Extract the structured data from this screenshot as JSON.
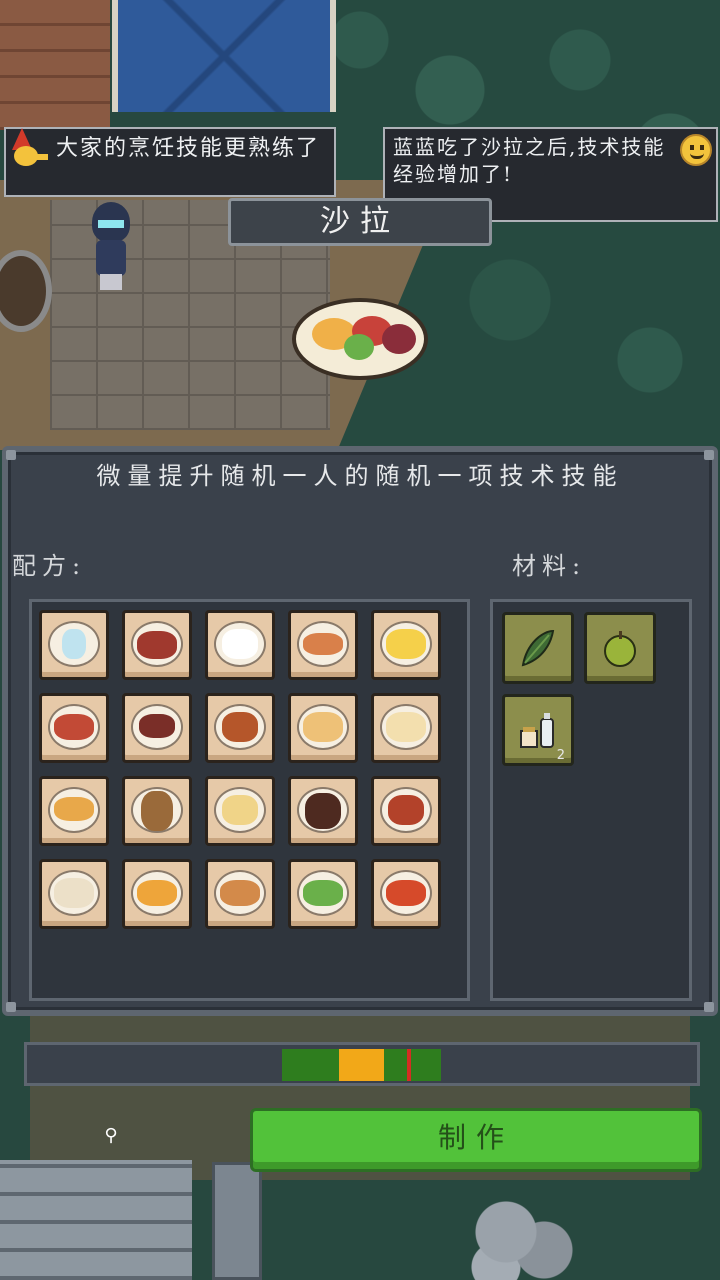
{
  "bubbles": {
    "left_text": "大家的烹饪技能更熟练了",
    "right_text": "蓝蓝吃了沙拉之后,技术技能经验增加了!"
  },
  "dish": {
    "name": "沙拉"
  },
  "panel": {
    "description": "微量提升随机一人的随机一项技术技能",
    "recipe_label": "配方:",
    "materials_label": "材料:"
  },
  "recipes": [
    {
      "icon": "water-glass"
    },
    {
      "icon": "steak"
    },
    {
      "icon": "eggs"
    },
    {
      "icon": "grilled-fish"
    },
    {
      "icon": "scrambled-eggs"
    },
    {
      "icon": "bacon"
    },
    {
      "icon": "steak-plate"
    },
    {
      "icon": "meat-sauce"
    },
    {
      "icon": "sandwich-toast"
    },
    {
      "icon": "bread-bun"
    },
    {
      "icon": "taco"
    },
    {
      "icon": "burger"
    },
    {
      "icon": "bread-plate"
    },
    {
      "icon": "chocolate-cake"
    },
    {
      "icon": "meatballs"
    },
    {
      "icon": "dumplings"
    },
    {
      "icon": "omelette-rice"
    },
    {
      "icon": "noodle-soup"
    },
    {
      "icon": "salad"
    },
    {
      "icon": "stir-fry"
    }
  ],
  "materials": [
    {
      "icon": "leafy-greens",
      "count": ""
    },
    {
      "icon": "green-apple",
      "count": ""
    },
    {
      "icon": "condiments",
      "count": "2"
    }
  ],
  "timing": {
    "green_zone": [
      0.384,
      0.62
    ],
    "yellow_zone": [
      0.468,
      0.535
    ],
    "cursor": 0.568
  },
  "craft_button": {
    "label": "制作"
  },
  "colors": {
    "craft": "#52c23a",
    "green_zone": "#2e7d1e",
    "yellow_zone": "#f2a818",
    "cursor": "#d42e22"
  }
}
